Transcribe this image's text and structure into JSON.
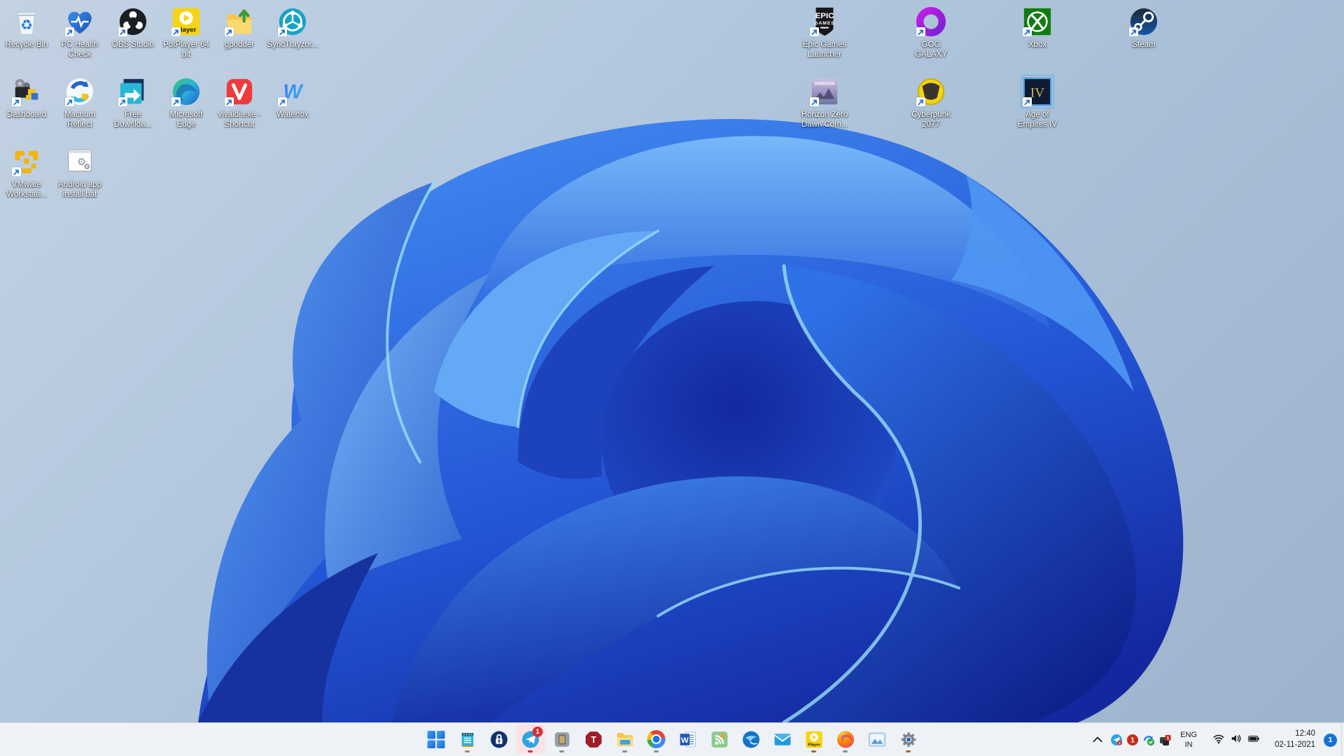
{
  "wallpaper": {
    "name": "windows-11-bloom"
  },
  "desktop": {
    "icons": [
      {
        "name": "recycle-bin",
        "label": "Recycle Bin",
        "icon": "recycle",
        "col": 0,
        "row": 0,
        "shortcut": false
      },
      {
        "name": "pc-health-check",
        "label": "PC Health Check",
        "icon": "heart",
        "col": 1,
        "row": 0,
        "shortcut": true
      },
      {
        "name": "obs-studio",
        "label": "OBS Studio",
        "icon": "obs",
        "col": 2,
        "row": 0,
        "shortcut": true
      },
      {
        "name": "potplayer-64-bit",
        "label": "PotPlayer 64 bit",
        "icon": "potplayer",
        "col": 3,
        "row": 0,
        "shortcut": true
      },
      {
        "name": "gpodder",
        "label": "gpodder",
        "icon": "folderup",
        "col": 4,
        "row": 0,
        "shortcut": true
      },
      {
        "name": "synctrayzor",
        "label": "SyncTrayzor...",
        "icon": "synctray",
        "col": 5,
        "row": 0,
        "shortcut": true
      },
      {
        "name": "epic-games-launcher",
        "label": "Epic Games Launcher",
        "icon": "epic",
        "col": 15,
        "row": 0,
        "shortcut": true
      },
      {
        "name": "gog-galaxy",
        "label": "GOG GALAXY",
        "icon": "gog",
        "col": 17,
        "row": 0,
        "shortcut": true
      },
      {
        "name": "xbox",
        "label": "Xbox",
        "icon": "xbox",
        "col": 19,
        "row": 0,
        "shortcut": true
      },
      {
        "name": "steam",
        "label": "Steam",
        "icon": "steam",
        "col": 21,
        "row": 0,
        "shortcut": true
      },
      {
        "name": "dashboard",
        "label": "Dashboard",
        "icon": "dashboard",
        "col": 0,
        "row": 1,
        "shortcut": true
      },
      {
        "name": "macrium-reflect",
        "label": "Macrium Reflect",
        "icon": "macrium",
        "col": 1,
        "row": 1,
        "shortcut": true
      },
      {
        "name": "free-download-manager",
        "label": "Free Downloa...",
        "icon": "fdm",
        "col": 2,
        "row": 1,
        "shortcut": true
      },
      {
        "name": "microsoft-edge",
        "label": "Microsoft Edge",
        "icon": "edge",
        "col": 3,
        "row": 1,
        "shortcut": true
      },
      {
        "name": "vivaldi-shortcut",
        "label": "vivaldi.exe - Shortcut",
        "icon": "vivaldi",
        "col": 4,
        "row": 1,
        "shortcut": true
      },
      {
        "name": "waterfox",
        "label": "Waterfox",
        "icon": "waterfox",
        "col": 5,
        "row": 1,
        "shortcut": true
      },
      {
        "name": "horizon-zero-dawn",
        "label": "Horizon Zero Dawn Com...",
        "icon": "horizon",
        "col": 15,
        "row": 1,
        "shortcut": true
      },
      {
        "name": "cyberpunk-2077",
        "label": "Cyberpunk 2077",
        "icon": "cyberpunk",
        "col": 17,
        "row": 1,
        "shortcut": true
      },
      {
        "name": "age-of-empires-iv",
        "label": "Age of Empires IV",
        "icon": "aoe4",
        "col": 19,
        "row": 1,
        "shortcut": true,
        "selected": true
      },
      {
        "name": "vmware-workstation",
        "label": "VMware Workstati...",
        "icon": "vmware",
        "col": 0,
        "row": 2,
        "shortcut": true
      },
      {
        "name": "android-app-install",
        "label": "Android app install.bat",
        "icon": "batfile",
        "col": 1,
        "row": 2,
        "shortcut": false
      }
    ]
  },
  "taskbar": {
    "apps": [
      {
        "name": "start-button",
        "icon": "start"
      },
      {
        "name": "notes-app",
        "icon": "notebook",
        "running": true
      },
      {
        "name": "keepass",
        "icon": "keepass"
      },
      {
        "name": "telegram",
        "icon": "telegram",
        "running": true,
        "attention": true,
        "badge": "1",
        "indicator": "#d13438"
      },
      {
        "name": "phone-app",
        "icon": "graydevice",
        "running": true
      },
      {
        "name": "t-app",
        "icon": "toctagon"
      },
      {
        "name": "file-explorer",
        "icon": "explorer",
        "running": true
      },
      {
        "name": "chrome",
        "icon": "chrome",
        "running": true
      },
      {
        "name": "word",
        "icon": "word"
      },
      {
        "name": "rss-reader",
        "icon": "rss"
      },
      {
        "name": "thunderbird",
        "icon": "thunderbird"
      },
      {
        "name": "mail",
        "icon": "mail"
      },
      {
        "name": "potplayer",
        "icon": "potplayer",
        "running": true,
        "indicator": "#b5651d"
      },
      {
        "name": "firefox",
        "icon": "firefox",
        "running": true
      },
      {
        "name": "photos",
        "icon": "photos"
      },
      {
        "name": "settings",
        "icon": "settings",
        "running": true,
        "indicator": "#b5651d"
      }
    ],
    "tray": {
      "overflow": [
        {
          "name": "telegram-tray",
          "icon": "telegrammini",
          "count": "1"
        },
        {
          "name": "unread-count",
          "icon": "redcount",
          "count": "1"
        },
        {
          "name": "sync-app",
          "icon": "synccheck"
        },
        {
          "name": "badged-app",
          "icon": "darkbadge",
          "count": "1"
        }
      ],
      "language": {
        "line1": "ENG",
        "line2": "IN"
      },
      "time": "12:40",
      "date": "02-11-2021",
      "notification_count": "1"
    }
  },
  "colors": {
    "wallpaper_sky": "#aec6df",
    "bloom_deep": "#13279e",
    "bloom_mid": "#2f6ce2",
    "bloom_light": "#5aa4f5",
    "bloom_cyan": "#9adef8",
    "taskbar_bg": "#f1f4f7",
    "badge_red": "#d13438",
    "notification_blue": "#1673d2"
  }
}
